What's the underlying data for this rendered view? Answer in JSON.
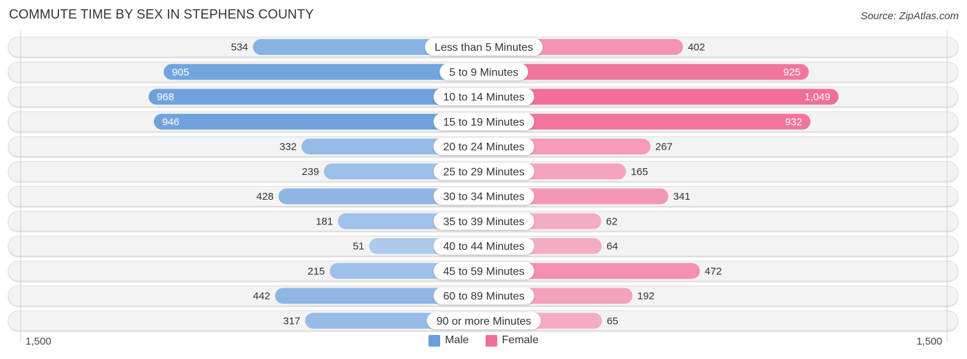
{
  "header": {
    "title": "COMMUTE TIME BY SEX IN STEPHENS COUNTY",
    "source": "Source: ZipAtlas.com"
  },
  "legend": {
    "male_label": "Male",
    "female_label": "Female"
  },
  "axis": {
    "left_label": "1,500",
    "right_label": "1,500"
  },
  "colors": {
    "male": "#6a9fdc",
    "female": "#f06f98",
    "male_light": "#b3cdee",
    "female_light": "#f7b3c8",
    "track": "#f3f3f3"
  },
  "chart_data": {
    "type": "bar",
    "orientation": "horizontal-diverging",
    "title": "COMMUTE TIME BY SEX IN STEPHENS COUNTY",
    "categories": [
      "Less than 5 Minutes",
      "5 to 9 Minutes",
      "10 to 14 Minutes",
      "15 to 19 Minutes",
      "20 to 24 Minutes",
      "25 to 29 Minutes",
      "30 to 34 Minutes",
      "35 to 39 Minutes",
      "40 to 44 Minutes",
      "45 to 59 Minutes",
      "60 to 89 Minutes",
      "90 or more Minutes"
    ],
    "series": [
      {
        "name": "Male",
        "side": "left",
        "values": [
          534,
          905,
          968,
          946,
          332,
          239,
          428,
          181,
          51,
          215,
          442,
          317
        ],
        "labels": [
          "534",
          "905",
          "968",
          "946",
          "332",
          "239",
          "428",
          "181",
          "51",
          "215",
          "442",
          "317"
        ]
      },
      {
        "name": "Female",
        "side": "right",
        "values": [
          402,
          925,
          1049,
          932,
          267,
          165,
          341,
          62,
          64,
          472,
          192,
          65
        ],
        "labels": [
          "402",
          "925",
          "1,049",
          "932",
          "267",
          "165",
          "341",
          "62",
          "64",
          "472",
          "192",
          "65"
        ]
      }
    ],
    "xlim": [
      -1500,
      1500
    ],
    "tick_labels": [
      "1,500",
      "1,500"
    ],
    "legend_position": "bottom-center",
    "grid": false
  }
}
